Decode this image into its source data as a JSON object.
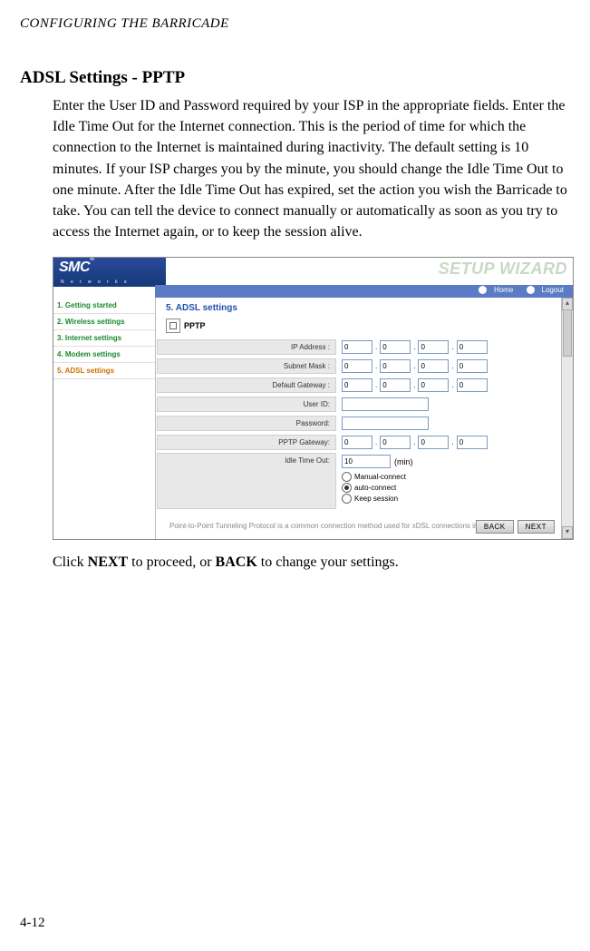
{
  "page": {
    "running_header": "CONFIGURING THE BARRICADE",
    "section_title": "ADSL Settings - PPTP",
    "intro_text": "Enter the User ID and Password required by your ISP in the appropriate fields. Enter the Idle Time Out for the Internet connection. This is the period of time for which the connection to the Internet is maintained during inactivity. The default setting is 10 minutes. If your ISP charges you by the minute, you should change the Idle Time Out to one minute. After the Idle Time Out has expired, set the action you wish the Barricade to take. You can tell the device to connect manually or automatically as soon as you try to access the Internet again, or to keep the session alive.",
    "below_prefix": "Click ",
    "below_next": "NEXT",
    "below_mid": " to proceed, or ",
    "below_back": "BACK",
    "below_suffix": " to change your settings.",
    "page_number": "4-12"
  },
  "screenshot": {
    "logo_text": "SMC",
    "logo_reg": "®",
    "logo_sub": "N e t w o r k s",
    "wizard_title": "SETUP WIZARD",
    "home_link": "Home",
    "logout_link": "Logout",
    "sidebar": {
      "items": [
        {
          "label": "1. Getting started"
        },
        {
          "label": "2. Wireless settings"
        },
        {
          "label": "3. Internet settings"
        },
        {
          "label": "4. Modem settings"
        },
        {
          "label": "5. ADSL settings"
        }
      ]
    },
    "panel_title": "5. ADSL settings",
    "pptp_label": "PPTP",
    "form": {
      "ip_label": "IP Address :",
      "ip": [
        "0",
        "0",
        "0",
        "0"
      ],
      "mask_label": "Subnet Mask :",
      "mask": [
        "0",
        "0",
        "0",
        "0"
      ],
      "gw_label": "Default Gateway :",
      "gw": [
        "0",
        "0",
        "0",
        "0"
      ],
      "user_label": "User ID:",
      "user_value": "",
      "pass_label": "Password:",
      "pass_value": "",
      "pptp_gw_label": "PPTP Gateway:",
      "pptp_gw": [
        "0",
        "0",
        "0",
        "0"
      ],
      "idle_label": "Idle Time Out:",
      "idle_value": "10",
      "idle_unit": "(min)",
      "radio_manual": "Manual-connect",
      "radio_auto": "auto-connect",
      "radio_keep": "Keep session"
    },
    "hint": "Point-to-Point Tunneling Protocol is a common connection method used for xDSL connections in Europe.",
    "back_btn": "BACK",
    "next_btn": "NEXT"
  }
}
